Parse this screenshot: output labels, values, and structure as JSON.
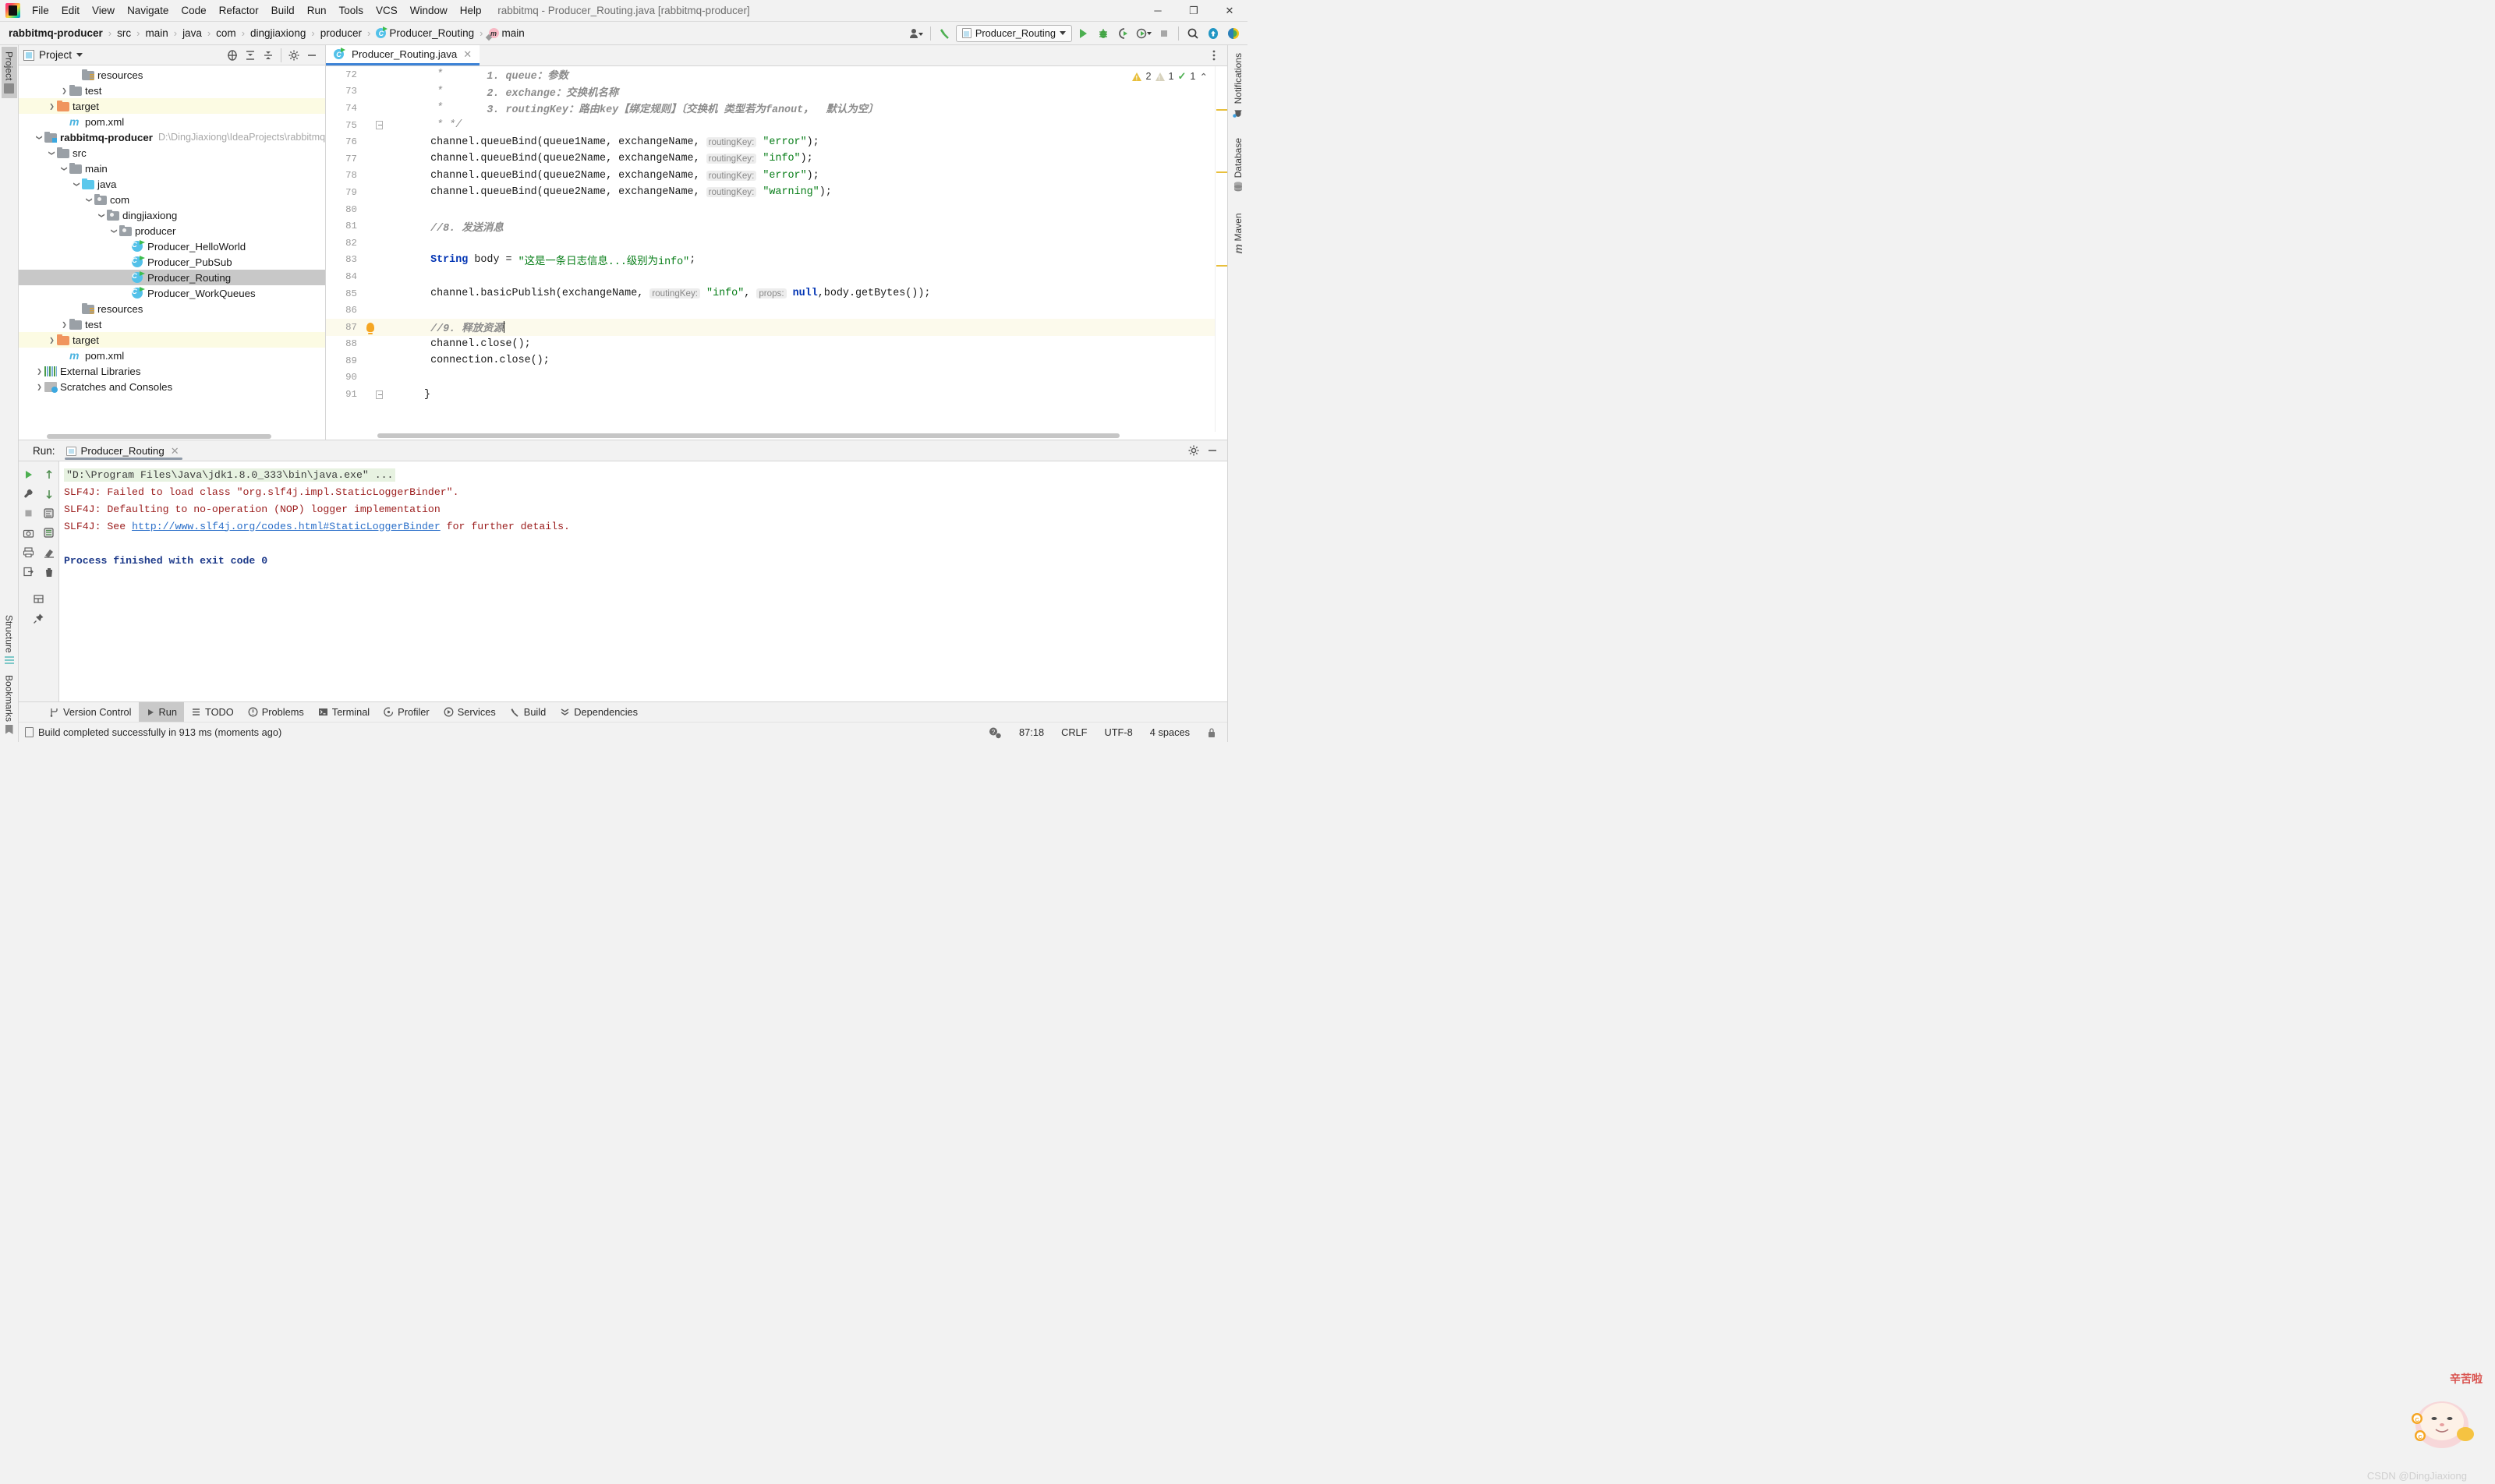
{
  "window": {
    "title": "rabbitmq - Producer_Routing.java [rabbitmq-producer]",
    "minimize": "─",
    "maximize": "❐",
    "close": "✕"
  },
  "menu": [
    {
      "label": "File"
    },
    {
      "label": "Edit"
    },
    {
      "label": "View"
    },
    {
      "label": "Navigate"
    },
    {
      "label": "Code"
    },
    {
      "label": "Refactor"
    },
    {
      "label": "Build"
    },
    {
      "label": "Run"
    },
    {
      "label": "Tools"
    },
    {
      "label": "VCS"
    },
    {
      "label": "Window"
    },
    {
      "label": "Help"
    }
  ],
  "breadcrumbs": [
    {
      "label": "rabbitmq-producer",
      "icon": "none",
      "bold": true
    },
    {
      "label": "src",
      "icon": "none",
      "bold": false
    },
    {
      "label": "main",
      "icon": "none",
      "bold": false
    },
    {
      "label": "java",
      "icon": "none",
      "bold": false
    },
    {
      "label": "com",
      "icon": "none",
      "bold": false
    },
    {
      "label": "dingjiaxiong",
      "icon": "none",
      "bold": false
    },
    {
      "label": "producer",
      "icon": "none",
      "bold": false
    },
    {
      "label": "Producer_Routing",
      "icon": "java-class-icon",
      "bold": false
    },
    {
      "label": "main",
      "icon": "method-icon",
      "bold": false
    }
  ],
  "toolbar": {
    "run_config_name": "Producer_Routing",
    "icons": [
      "user-dropdown-icon",
      "build-hammer-icon",
      "run-icon",
      "debug-icon",
      "run-coverage-icon",
      "profile-icon",
      "stop-icon",
      "search-everywhere-icon",
      "updates-icon",
      "ide-helper-icon"
    ]
  },
  "left_stripe": {
    "top": [
      {
        "label": "Project",
        "active": true
      }
    ],
    "bottom": [
      {
        "label": "Structure",
        "active": false
      },
      {
        "label": "Bookmarks",
        "active": false
      }
    ]
  },
  "right_stripe": [
    {
      "label": "Notifications",
      "icon": "bell-icon"
    },
    {
      "label": "Database",
      "icon": "database-icon"
    },
    {
      "label": "Maven",
      "icon": "maven-icon"
    }
  ],
  "project_panel": {
    "title": "Project",
    "actions": [
      "locate-icon",
      "expand-all-icon",
      "collapse-all-icon",
      "settings-gear-icon",
      "hide-icon"
    ],
    "tree": [
      {
        "label": "resources",
        "indent": 4,
        "arrow": "none",
        "icon": "resources-folder-icon",
        "path": "",
        "state": "normal"
      },
      {
        "label": "test",
        "indent": 3,
        "arrow": "right",
        "icon": "folder-icon",
        "path": "",
        "state": "normal"
      },
      {
        "label": "target",
        "indent": 2,
        "arrow": "right",
        "icon": "orange-folder-icon",
        "path": "",
        "state": "highlight"
      },
      {
        "label": "pom.xml",
        "indent": 3,
        "arrow": "none",
        "icon": "maven-file-icon",
        "path": "",
        "state": "normal"
      },
      {
        "label": "rabbitmq-producer",
        "indent": 1,
        "arrow": "down",
        "icon": "module-folder-icon",
        "path": "D:\\DingJiaxiong\\IdeaProjects\\rabbitmq\\ra",
        "state": "normal",
        "bold": true
      },
      {
        "label": "src",
        "indent": 2,
        "arrow": "down",
        "icon": "folder-icon",
        "path": "",
        "state": "normal"
      },
      {
        "label": "main",
        "indent": 3,
        "arrow": "down",
        "icon": "folder-icon",
        "path": "",
        "state": "normal"
      },
      {
        "label": "java",
        "indent": 4,
        "arrow": "down",
        "icon": "blue-folder-icon",
        "path": "",
        "state": "normal"
      },
      {
        "label": "com",
        "indent": 5,
        "arrow": "down",
        "icon": "package-folder-icon",
        "path": "",
        "state": "normal"
      },
      {
        "label": "dingjiaxiong",
        "indent": 6,
        "arrow": "down",
        "icon": "package-folder-icon",
        "path": "",
        "state": "normal"
      },
      {
        "label": "producer",
        "indent": 7,
        "arrow": "down",
        "icon": "package-folder-icon",
        "path": "",
        "state": "normal"
      },
      {
        "label": "Producer_HelloWorld",
        "indent": 8,
        "arrow": "none",
        "icon": "java-class-icon",
        "path": "",
        "state": "normal"
      },
      {
        "label": "Producer_PubSub",
        "indent": 8,
        "arrow": "none",
        "icon": "java-class-icon",
        "path": "",
        "state": "normal"
      },
      {
        "label": "Producer_Routing",
        "indent": 8,
        "arrow": "none",
        "icon": "java-class-icon",
        "path": "",
        "state": "selected"
      },
      {
        "label": "Producer_WorkQueues",
        "indent": 8,
        "arrow": "none",
        "icon": "java-class-icon",
        "path": "",
        "state": "normal"
      },
      {
        "label": "resources",
        "indent": 4,
        "arrow": "none",
        "icon": "resources-folder-icon",
        "path": "",
        "state": "normal"
      },
      {
        "label": "test",
        "indent": 3,
        "arrow": "right",
        "icon": "folder-icon",
        "path": "",
        "state": "normal"
      },
      {
        "label": "target",
        "indent": 2,
        "arrow": "right",
        "icon": "orange-folder-icon",
        "path": "",
        "state": "highlight"
      },
      {
        "label": "pom.xml",
        "indent": 3,
        "arrow": "none",
        "icon": "maven-file-icon",
        "path": "",
        "state": "normal"
      },
      {
        "label": "External Libraries",
        "indent": 1,
        "arrow": "right",
        "icon": "libraries-icon",
        "path": "",
        "state": "normal"
      },
      {
        "label": "Scratches and Consoles",
        "indent": 1,
        "arrow": "right",
        "icon": "scratches-icon",
        "path": "",
        "state": "normal"
      }
    ]
  },
  "editor": {
    "tab": {
      "label": "Producer_Routing.java",
      "icon": "java-class-icon",
      "close": "✕"
    },
    "inspections": {
      "warnings": "2",
      "weak_warnings": "1",
      "checks": "1",
      "collapse": "⌃"
    },
    "first_line_number": 72,
    "lines": [
      {
        "n": 72,
        "bulb": false,
        "fold": "none",
        "hl": false,
        "spans": [
          {
            "t": "   * ",
            "c": "c"
          },
          {
            "t": "      1. queue：参数",
            "c": "cb"
          }
        ]
      },
      {
        "n": 73,
        "bulb": false,
        "fold": "none",
        "hl": false,
        "spans": [
          {
            "t": "   * ",
            "c": "c"
          },
          {
            "t": "      2. exchange：交换机名称",
            "c": "cb"
          }
        ]
      },
      {
        "n": 74,
        "bulb": false,
        "fold": "none",
        "hl": false,
        "spans": [
          {
            "t": "   * ",
            "c": "c"
          },
          {
            "t": "      3. routingKey：路由key【绑定规则】〔交换机 类型若为fanout，  默认为空〕",
            "c": "cb"
          }
        ]
      },
      {
        "n": 75,
        "bulb": false,
        "fold": "bottom",
        "hl": false,
        "spans": [
          {
            "t": "   * */",
            "c": "c"
          }
        ]
      },
      {
        "n": 76,
        "bulb": false,
        "fold": "none",
        "hl": false,
        "spans": [
          {
            "t": "  channel.queueBind(queue1Name, exchangeName, ",
            "c": "plain"
          },
          {
            "t": "routingKey:",
            "c": "hint"
          },
          {
            "t": " ",
            "c": "plain"
          },
          {
            "t": "\"error\"",
            "c": "s"
          },
          {
            "t": ");",
            "c": "plain"
          }
        ]
      },
      {
        "n": 77,
        "bulb": false,
        "fold": "none",
        "hl": false,
        "spans": [
          {
            "t": "  channel.queueBind(queue2Name, exchangeName, ",
            "c": "plain"
          },
          {
            "t": "routingKey:",
            "c": "hint"
          },
          {
            "t": " ",
            "c": "plain"
          },
          {
            "t": "\"info\"",
            "c": "s"
          },
          {
            "t": ");",
            "c": "plain"
          }
        ]
      },
      {
        "n": 78,
        "bulb": false,
        "fold": "none",
        "hl": false,
        "spans": [
          {
            "t": "  channel.queueBind(queue2Name, exchangeName, ",
            "c": "plain"
          },
          {
            "t": "routingKey:",
            "c": "hint"
          },
          {
            "t": " ",
            "c": "plain"
          },
          {
            "t": "\"error\"",
            "c": "s"
          },
          {
            "t": ");",
            "c": "plain"
          }
        ]
      },
      {
        "n": 79,
        "bulb": false,
        "fold": "none",
        "hl": false,
        "spans": [
          {
            "t": "  channel.queueBind(queue2Name, exchangeName, ",
            "c": "plain"
          },
          {
            "t": "routingKey:",
            "c": "hint"
          },
          {
            "t": " ",
            "c": "plain"
          },
          {
            "t": "\"warning\"",
            "c": "s"
          },
          {
            "t": ");",
            "c": "plain"
          }
        ]
      },
      {
        "n": 80,
        "bulb": false,
        "fold": "none",
        "hl": false,
        "spans": []
      },
      {
        "n": 81,
        "bulb": false,
        "fold": "none",
        "hl": false,
        "spans": [
          {
            "t": "  //8. 发送消息",
            "c": "cb"
          }
        ]
      },
      {
        "n": 82,
        "bulb": false,
        "fold": "none",
        "hl": false,
        "spans": []
      },
      {
        "n": 83,
        "bulb": false,
        "fold": "none",
        "hl": false,
        "spans": [
          {
            "t": "  ",
            "c": "plain"
          },
          {
            "t": "String",
            "c": "k"
          },
          {
            "t": " body = ",
            "c": "plain"
          },
          {
            "t": "\"这是一条日志信息...级别为info\"",
            "c": "s"
          },
          {
            "t": ";",
            "c": "plain"
          }
        ]
      },
      {
        "n": 84,
        "bulb": false,
        "fold": "none",
        "hl": false,
        "spans": []
      },
      {
        "n": 85,
        "bulb": false,
        "fold": "none",
        "hl": false,
        "spans": [
          {
            "t": "  channel.basicPublish(exchangeName, ",
            "c": "plain"
          },
          {
            "t": "routingKey:",
            "c": "hint"
          },
          {
            "t": " ",
            "c": "plain"
          },
          {
            "t": "\"info\"",
            "c": "s"
          },
          {
            "t": ", ",
            "c": "plain"
          },
          {
            "t": "props:",
            "c": "hint"
          },
          {
            "t": " ",
            "c": "plain"
          },
          {
            "t": "null",
            "c": "k"
          },
          {
            "t": ",body.getBytes());",
            "c": "plain"
          }
        ]
      },
      {
        "n": 86,
        "bulb": false,
        "fold": "none",
        "hl": false,
        "spans": []
      },
      {
        "n": 87,
        "bulb": true,
        "fold": "none",
        "hl": true,
        "spans": [
          {
            "t": "  //9. 释放资源",
            "c": "cb"
          },
          {
            "t": "CARET",
            "c": "caret"
          }
        ]
      },
      {
        "n": 88,
        "bulb": false,
        "fold": "none",
        "hl": false,
        "spans": [
          {
            "t": "  channel.close();",
            "c": "plain"
          }
        ]
      },
      {
        "n": 89,
        "bulb": false,
        "fold": "none",
        "hl": false,
        "spans": [
          {
            "t": "  connection.close();",
            "c": "plain"
          }
        ]
      },
      {
        "n": 90,
        "bulb": false,
        "fold": "none",
        "hl": false,
        "spans": []
      },
      {
        "n": 91,
        "bulb": false,
        "fold": "end",
        "hl": false,
        "spans": [
          {
            "t": " }",
            "c": "plain"
          }
        ]
      }
    ]
  },
  "run_panel": {
    "label": "Run:",
    "tab": {
      "label": "Producer_Routing",
      "close": "✕"
    },
    "header_actions": [
      "settings-gear-icon",
      "hide-icon"
    ],
    "tools": [
      "rerun-icon",
      "up-stack-icon",
      "wrench-icon",
      "down-stack-icon",
      "stop-icon",
      "soft-wrap-icon",
      "camera-icon",
      "scroll-end-icon",
      "print-icon",
      "clear-all-icon",
      "export-icon",
      "trash-icon",
      "layout-icon",
      "pin-icon"
    ],
    "console": [
      {
        "text": "\"D:\\Program Files\\Java\\jdk1.8.0_333\\bin\\java.exe\" ...",
        "style": "cmd"
      },
      {
        "text": "SLF4J: Failed to load class \"org.slf4j.impl.StaticLoggerBinder\".",
        "style": "err"
      },
      {
        "text": "SLF4J: Defaulting to no-operation (NOP) logger implementation",
        "style": "err"
      },
      {
        "text": "SLF4J: See ",
        "style": "err",
        "link": "http://www.slf4j.org/codes.html#StaticLoggerBinder",
        "suffix": " for further details."
      },
      {
        "text": "",
        "style": "blank"
      },
      {
        "text": "Process finished with exit code 0",
        "style": "ok"
      }
    ]
  },
  "bottom_stripe": [
    {
      "label": "Version Control",
      "icon": "branch-icon",
      "active": false
    },
    {
      "label": "Run",
      "icon": "run-icon",
      "active": true
    },
    {
      "label": "TODO",
      "icon": "todo-icon",
      "active": false
    },
    {
      "label": "Problems",
      "icon": "problems-icon",
      "active": false
    },
    {
      "label": "Terminal",
      "icon": "terminal-icon",
      "active": false
    },
    {
      "label": "Profiler",
      "icon": "profiler-icon",
      "active": false
    },
    {
      "label": "Services",
      "icon": "services-icon",
      "active": false
    },
    {
      "label": "Build",
      "icon": "build-icon",
      "active": false
    },
    {
      "label": "Dependencies",
      "icon": "dependencies-icon",
      "active": false
    }
  ],
  "statusbar": {
    "message": "Build completed successfully in 913 ms (moments ago)",
    "caret_position": "87:18",
    "line_separator": "CRLF",
    "encoding": "UTF-8",
    "indent": "4 spaces",
    "watermark": "CSDN @DingJiaxiong"
  },
  "colors": {
    "accent": "#3d82d6",
    "string_green": "#067d17",
    "keyword_blue": "#0033b3",
    "error_red": "#9b1c1c",
    "success_blue": "#1d3a8a",
    "highlight_yellow": "#fcfaec"
  }
}
